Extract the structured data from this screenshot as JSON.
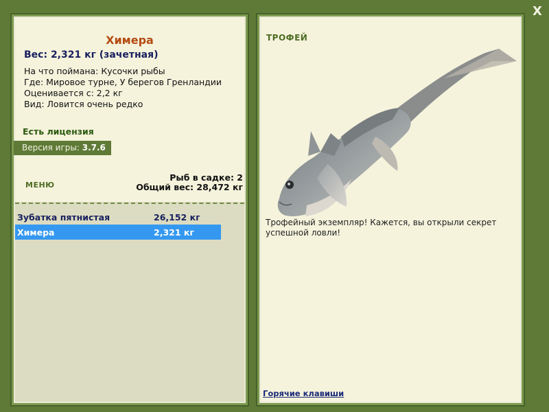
{
  "window": {
    "close_label": "X"
  },
  "fish": {
    "name": "Химера",
    "weight_line": "Вес: 2,321 кг (зачетная)",
    "details": [
      "На что поймана: Кусочки рыбы",
      "Где: Мировое турне, У берегов Гренландии",
      "Оценивается с: 2,2 кг",
      "Вид: Ловится очень редко"
    ]
  },
  "license": "Есть лицензия",
  "version": {
    "label": "Версия игры:",
    "value": "3.7.6"
  },
  "menu_label": "МЕНЮ",
  "cage": {
    "count_line": "Рыб в садке: 2",
    "total_line": "Общий вес: 28,472 кг"
  },
  "catch_list": [
    {
      "name": "Зубатка пятнистая",
      "weight": "26,152 кг",
      "selected": false
    },
    {
      "name": "Химера",
      "weight": "2,321 кг",
      "selected": true
    }
  ],
  "trophy": {
    "title": "ТРОФЕЙ",
    "text": "Трофейный экземпляр! Кажется, вы открыли секрет успешной ловли!"
  },
  "hotkeys_label": "Горячие клавиши",
  "icons": {
    "close": "close-icon",
    "fish_image": "chimera-fish-image"
  },
  "colors": {
    "frame": "#5e7a36",
    "panel": "#f5f3dc",
    "title": "#b54a12",
    "selected_row": "#3598f0",
    "accent_green": "#4d6b22"
  }
}
